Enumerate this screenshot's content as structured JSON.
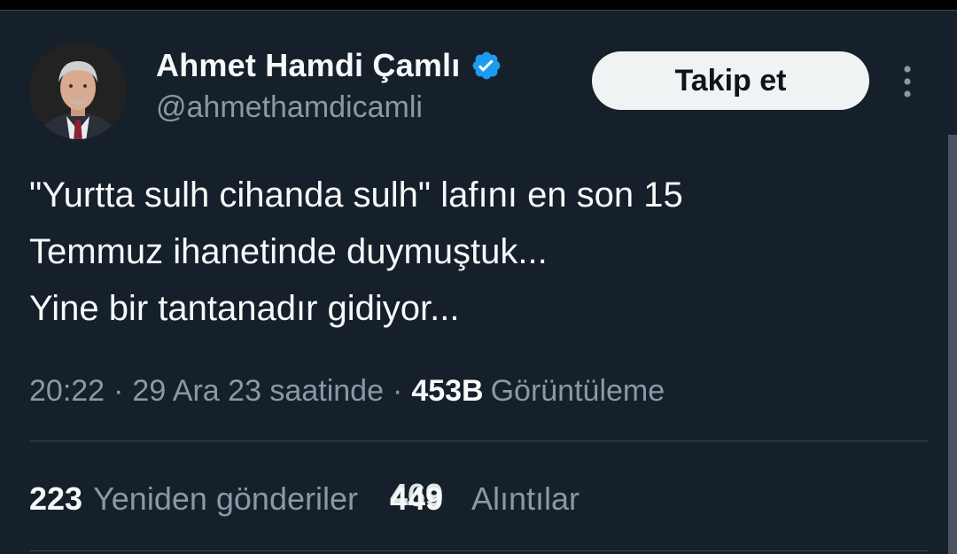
{
  "author": {
    "display_name": "Ahmet Hamdi Çamlı",
    "handle": "@ahmethamdicamli",
    "avatar_icon": "profile-photo",
    "verified_color": "#1d9bf0"
  },
  "actions": {
    "follow_label": "Takip et",
    "more_icon": "more-vertical-icon"
  },
  "tweet": {
    "lines": [
      "\"Yurtta sulh cihanda sulh\" lafını en son 15",
      "Temmuz ihanetinde duymuştuk...",
      "Yine bir tantanadır gidiyor..."
    ]
  },
  "meta": {
    "time": "20:22",
    "separator": "·",
    "date": "29 Ara 23 saatinde",
    "views_count": "453B",
    "views_label": "Görüntüleme"
  },
  "stats": {
    "reposts_count": "223",
    "reposts_label": "Yeniden gönderiler",
    "quotes_count_a": "449",
    "quotes_count_b": "469",
    "quotes_label": "Alıntılar"
  },
  "colors": {
    "background": "#15202b",
    "text_primary": "#f7f9f9",
    "text_secondary": "#8b98a5",
    "divider": "#38444d",
    "button_bg": "#eff3f4"
  }
}
